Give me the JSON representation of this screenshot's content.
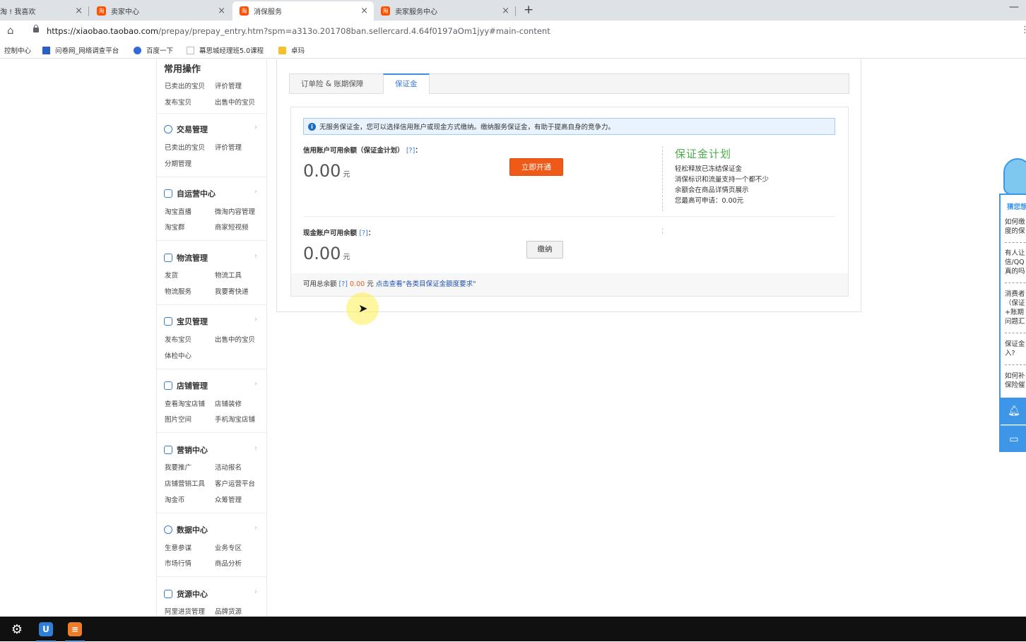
{
  "browser": {
    "tabs": [
      {
        "label": "淘 ! 我喜欢",
        "active": false
      },
      {
        "label": "卖家中心",
        "active": false
      },
      {
        "label": "消保服务",
        "active": true
      },
      {
        "label": "卖家服务中心",
        "active": false
      }
    ],
    "new_tab": "+",
    "minimize": "—",
    "close_glyph": "×",
    "url_main": "https://xiaobao.taobao.com",
    "url_rest": "/prepay/prepay_entry.htm?spm=a313o.201708ban.sellercard.4.64f0197aOm1jyy#main-content",
    "bookmarks": [
      {
        "label": "控制中心"
      },
      {
        "label": "问卷网_网络调查平台"
      },
      {
        "label": "百度一下"
      },
      {
        "label": "幕思城经理班5.0课程"
      },
      {
        "label": "卓玛"
      }
    ]
  },
  "sidebar": {
    "common_title": "常用操作",
    "common_links": [
      "已卖出的宝贝",
      "评价管理",
      "发布宝贝",
      "出售中的宝贝"
    ],
    "sections": [
      {
        "title": "交易管理",
        "links": [
          "已卖出的宝贝",
          "评价管理",
          "分期管理"
        ]
      },
      {
        "title": "自运营中心",
        "links": [
          "淘宝直播",
          "微淘内容管理",
          "淘宝群",
          "商家短视频"
        ]
      },
      {
        "title": "物流管理",
        "links": [
          "发货",
          "物流工具",
          "物流服务",
          "我要寄快递"
        ]
      },
      {
        "title": "宝贝管理",
        "links": [
          "发布宝贝",
          "出售中的宝贝",
          "体检中心"
        ]
      },
      {
        "title": "店铺管理",
        "links": [
          "查看淘宝店铺",
          "店铺装修",
          "图片空间",
          "手机淘宝店铺"
        ]
      },
      {
        "title": "营销中心",
        "links": [
          "我要推广",
          "活动报名",
          "店铺营销工具",
          "客户运营平台",
          "淘金币",
          "众筹管理"
        ]
      },
      {
        "title": "数据中心",
        "links": [
          "生意参谋",
          "业务专区",
          "市场行情",
          "商品分析"
        ]
      },
      {
        "title": "货源中心",
        "links": [
          "阿里进货管理",
          "品牌货源"
        ]
      }
    ]
  },
  "main": {
    "tabs": [
      {
        "label": "订单险 & 账期保障",
        "active": false
      },
      {
        "label": "保证金",
        "active": true
      }
    ],
    "notice": "无服务保证金，您可以选择信用账户或现金方式缴纳。缴纳服务保证金，有助于提高自身的竞争力。",
    "credit_label": "信用账户可用余额（保证金计划）",
    "help_mark": "[?]",
    "colon": "：",
    "credit_amount": "0.00",
    "unit": "元",
    "open_button": "立即开通",
    "plan_logo": "保证金计划",
    "plan_lines": [
      "轻松释放已冻结保证金",
      "消保标识和流量支持一个都不少",
      "余额会在商品详情页展示",
      "您最高可申请：0.00元"
    ],
    "cash_label": "现金账户可用余额",
    "cash_amount": "0.00",
    "pay_button": "缴纳",
    "total_label": "可用总余额",
    "total_amount": "0.00",
    "total_unit": "元",
    "requirements_link": "点击查看\"各类目保证金额度要求\""
  },
  "helper": {
    "title": "猜您想问",
    "questions": [
      [
        "如何缴",
        "度的保"
      ],
      [
        "有人让",
        "信/QQ",
        "真的吗"
      ],
      [
        "消费者",
        "（保证",
        "+账期",
        "问题汇"
      ],
      [
        "保证金",
        "入?"
      ],
      [
        "如何补",
        "保险催"
      ]
    ],
    "bell_icon": "🔔",
    "chat_icon": "💬"
  },
  "taskbar": {
    "items": [
      "settings",
      "u-app",
      "chat-app"
    ]
  }
}
